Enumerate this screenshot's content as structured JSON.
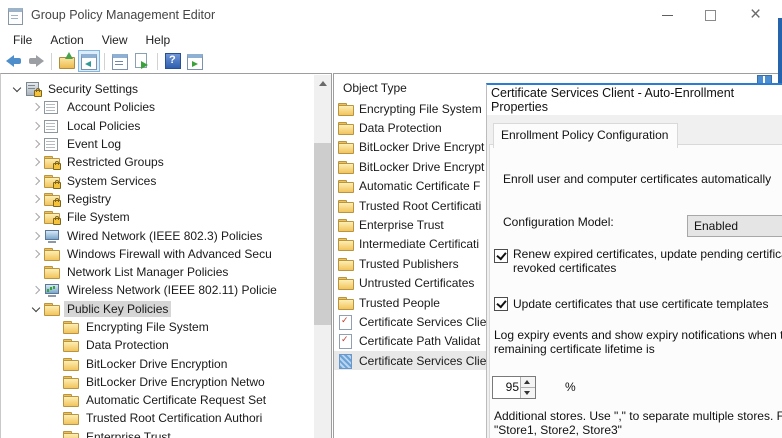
{
  "window": {
    "title": "Group Policy Management Editor",
    "controls": [
      "minimize",
      "maximize",
      "close"
    ]
  },
  "menu": {
    "items": [
      "File",
      "Action",
      "View",
      "Help"
    ]
  },
  "toolbar": {
    "icons": [
      {
        "name": "back"
      },
      {
        "name": "forward"
      },
      {
        "name": "separator"
      },
      {
        "name": "up-one-level"
      },
      {
        "name": "show-console-tree",
        "active": true
      },
      {
        "name": "separator"
      },
      {
        "name": "properties-window"
      },
      {
        "name": "export-list"
      },
      {
        "name": "separator"
      },
      {
        "name": "help"
      },
      {
        "name": "show-action-pane"
      }
    ]
  },
  "tree": {
    "items": [
      {
        "label": "Security Settings",
        "level": 0,
        "expander": "expanded",
        "icon": "server-lock"
      },
      {
        "label": "Account Policies",
        "level": 1,
        "expander": "collapsed",
        "icon": "table"
      },
      {
        "label": "Local Policies",
        "level": 1,
        "expander": "collapsed",
        "icon": "table"
      },
      {
        "label": "Event Log",
        "level": 1,
        "expander": "collapsed",
        "icon": "table"
      },
      {
        "label": "Restricted Groups",
        "level": 1,
        "expander": "collapsed",
        "icon": "folder-lock"
      },
      {
        "label": "System Services",
        "level": 1,
        "expander": "collapsed",
        "icon": "folder-lock"
      },
      {
        "label": "Registry",
        "level": 1,
        "expander": "collapsed",
        "icon": "folder-lock"
      },
      {
        "label": "File System",
        "level": 1,
        "expander": "collapsed",
        "icon": "folder-lock"
      },
      {
        "label": "Wired Network (IEEE 802.3) Policies",
        "level": 1,
        "expander": "collapsed",
        "icon": "monitor"
      },
      {
        "label": "Windows Firewall with Advanced Secu",
        "level": 1,
        "expander": "collapsed",
        "icon": "folder"
      },
      {
        "label": "Network List Manager Policies",
        "level": 1,
        "expander": "none",
        "icon": "folder"
      },
      {
        "label": "Wireless Network (IEEE 802.11) Policie",
        "level": 1,
        "expander": "collapsed",
        "icon": "monitor-green"
      },
      {
        "label": "Public Key Policies",
        "level": 1,
        "expander": "expanded",
        "icon": "folder",
        "selected": true
      },
      {
        "label": "Encrypting File System",
        "level": 2,
        "expander": "none",
        "icon": "folder"
      },
      {
        "label": "Data Protection",
        "level": 2,
        "expander": "none",
        "icon": "folder"
      },
      {
        "label": "BitLocker Drive Encryption",
        "level": 2,
        "expander": "none",
        "icon": "folder"
      },
      {
        "label": "BitLocker Drive Encryption Netwo",
        "level": 2,
        "expander": "none",
        "icon": "folder"
      },
      {
        "label": "Automatic Certificate Request Set",
        "level": 2,
        "expander": "none",
        "icon": "folder"
      },
      {
        "label": "Trusted Root Certification Authori",
        "level": 2,
        "expander": "none",
        "icon": "folder"
      },
      {
        "label": "Enterprise Trust",
        "level": 2,
        "expander": "none",
        "icon": "folder"
      }
    ]
  },
  "list": {
    "header": "Object Type",
    "items": [
      {
        "label": "Encrypting File System",
        "icon": "folder"
      },
      {
        "label": "Data Protection",
        "icon": "folder"
      },
      {
        "label": "BitLocker Drive Encrypt",
        "icon": "folder"
      },
      {
        "label": "BitLocker Drive Encrypt",
        "icon": "folder"
      },
      {
        "label": "Automatic Certificate F",
        "icon": "folder"
      },
      {
        "label": "Trusted Root Certificati",
        "icon": "folder"
      },
      {
        "label": "Enterprise Trust",
        "icon": "folder"
      },
      {
        "label": "Intermediate Certificati",
        "icon": "folder"
      },
      {
        "label": "Trusted Publishers",
        "icon": "folder"
      },
      {
        "label": "Untrusted Certificates",
        "icon": "folder"
      },
      {
        "label": "Trusted People",
        "icon": "folder"
      },
      {
        "label": "Certificate Services Clie",
        "icon": "cert"
      },
      {
        "label": "Certificate Path Validat",
        "icon": "cert"
      },
      {
        "label": "Certificate Services Clie",
        "icon": "cert-sel",
        "selected": true
      }
    ]
  },
  "dialog": {
    "title": "Certificate Services Client - Auto-Enrollment Properties",
    "tab": "Enrollment Policy Configuration",
    "intro": "Enroll user and computer certificates automatically",
    "config_model_label": "Configuration Model:",
    "config_model_value": "Enabled",
    "renew_checked": true,
    "renew_line1": "Renew expired certificates, update pending certificates",
    "renew_line2": "revoked certificates",
    "update_checked": true,
    "update_label": "Update certificates that use certificate templates",
    "log_line1": "Log expiry events and show expiry notifications when the p",
    "log_line2": "remaining certificate lifetime is",
    "expiry_value": "95",
    "percent_label": "%",
    "stores_line1": "Additional stores. Use \",\" to separate multiple stores. For e",
    "stores_line2": "\"Store1, Store2, Store3\""
  },
  "colors": {
    "accent_blue": "#2b7cd3",
    "selection_gray": "#d6d6d6",
    "folder_yellow": "#f2c45c"
  }
}
